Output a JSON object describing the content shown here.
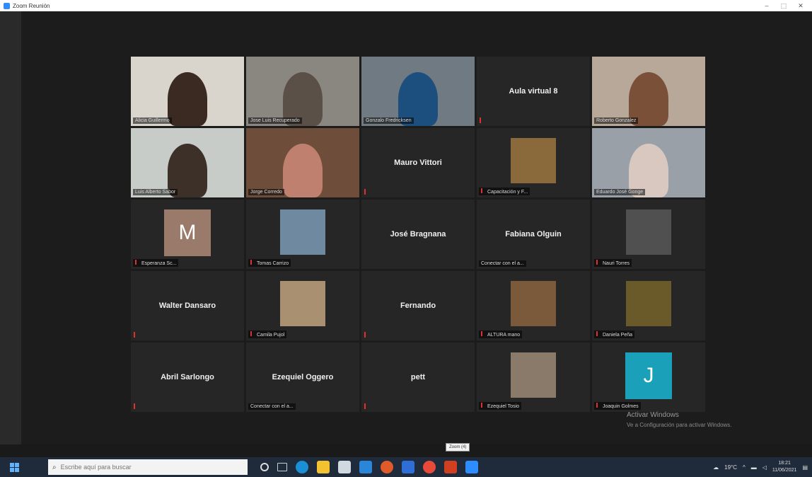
{
  "window": {
    "title": "Zoom Reunión",
    "controls": [
      "–",
      "⬚",
      "✕"
    ]
  },
  "tiles": [
    {
      "type": "video",
      "label": "Alicia Guillermo",
      "bg": "#d9d4cc",
      "person": "#3a2a22",
      "active": false
    },
    {
      "type": "video",
      "label": "Jose Luis Recuperado",
      "bg": "#8a8680",
      "person": "#5a5048",
      "active": false
    },
    {
      "type": "video",
      "label": "Gonzalo Fredricksen",
      "bg": "#6f7a82",
      "person": "#1d4f7e",
      "active": false
    },
    {
      "type": "name",
      "name": "Aula virtual 8",
      "muted": true
    },
    {
      "type": "video",
      "label": "Roberto Gonzalez",
      "bg": "#b8a89a",
      "person": "#7a5038",
      "active": false
    },
    {
      "type": "video",
      "label": "Luis Alberto Sabor",
      "bg": "#c8ccc8",
      "person": "#3c3028",
      "active": true
    },
    {
      "type": "video",
      "label": "Jorge Corredo",
      "bg": "#6e4e3a",
      "person": "#c08070",
      "active": false
    },
    {
      "type": "name",
      "name": "Mauro Vittori",
      "muted": true
    },
    {
      "type": "thumb",
      "label": "Capacitación y F...",
      "bg": "#8a6a3a",
      "muted": true
    },
    {
      "type": "video",
      "label": "Eduardo José Gonge",
      "bg": "#9aa0a8",
      "person": "#d8c8c0",
      "active": false
    },
    {
      "type": "avatar",
      "letter": "M",
      "color": "#9a7a6a",
      "label": "Esperanza Sc...",
      "muted": true
    },
    {
      "type": "thumb",
      "label": "Tomas Carrizo",
      "bg": "#6f8aa0",
      "muted": true
    },
    {
      "type": "name",
      "name": "José Bragnana",
      "muted": false
    },
    {
      "type": "name",
      "name": "Fabiana Olguin",
      "muted": false,
      "label": "Conectar con el a..."
    },
    {
      "type": "thumb",
      "label": "Nauri Torres",
      "bg": "#505050",
      "muted": true
    },
    {
      "type": "name",
      "name": "Walter Dansaro",
      "muted": true
    },
    {
      "type": "thumb",
      "label": "Camila Pujol",
      "bg": "#a89070",
      "muted": true
    },
    {
      "type": "name",
      "name": "Fernando",
      "muted": true
    },
    {
      "type": "thumb",
      "label": "ALTURA mano",
      "bg": "#7a5a3a",
      "muted": true
    },
    {
      "type": "thumb",
      "label": "Daniela Peña",
      "bg": "#6a5a2a",
      "muted": true
    },
    {
      "type": "name",
      "name": "Abril Sarlongo",
      "muted": true
    },
    {
      "type": "name",
      "name": "Ezequiel Oggero",
      "muted": false,
      "label": "Conectar con el a..."
    },
    {
      "type": "name",
      "name": "pett",
      "muted": true
    },
    {
      "type": "thumb",
      "label": "Ezequiel Tosio",
      "bg": "#8a7a6a",
      "muted": true
    },
    {
      "type": "avatar",
      "letter": "J",
      "color": "#1aa0b8",
      "label": "Joaquin Golmes",
      "muted": true
    }
  ],
  "watermark": {
    "line1": "Activar Windows",
    "line2": "Ve a Configuración para activar Windows."
  },
  "tooltip": "Zoom (4)",
  "taskbar": {
    "search_placeholder": "Escribe aquí para buscar",
    "weather": "19°C",
    "time": "18:21",
    "date": "11/06/2021"
  }
}
